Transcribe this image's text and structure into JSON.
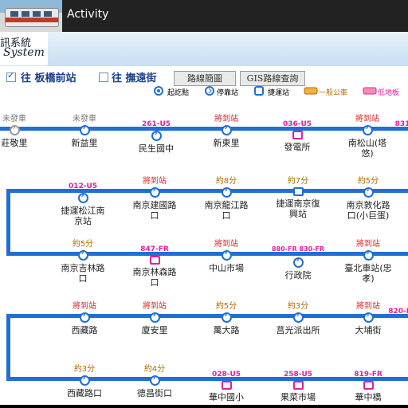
{
  "window": {
    "title": "Activity"
  },
  "banner": {
    "line1": "訊系統",
    "line2": "System"
  },
  "controls": {
    "dir1": "往 板橋前站",
    "dir1_checked": true,
    "dir2": "往 撫遠街",
    "dir2_checked": false,
    "btn_route_map": "路線簡圖",
    "btn_gis": "GIS路線查詢"
  },
  "legend": {
    "start": "起訖點",
    "stop": "停靠站",
    "mrt": "捷運站",
    "general_bus": "一般公車",
    "low_floor": "低地板"
  },
  "rows": [
    {
      "stops": [
        {
          "status": "未發車",
          "status_color": "gray",
          "name": "莊敬里",
          "node": "gray"
        },
        {
          "status": "未發車",
          "status_color": "gray",
          "name": "新益里",
          "node": "blue"
        },
        {
          "status": "261-U5",
          "status_color": "plate",
          "name": "民生國中",
          "node": "blue"
        },
        {
          "status": "將到站",
          "status_color": "red",
          "name": "新東里",
          "node": "blue"
        },
        {
          "status": "036-U5",
          "status_color": "plate",
          "name": "發電所",
          "node": "bus"
        },
        {
          "status": "將到站",
          "status_color": "red",
          "name": "南松山(塔悠)",
          "node": "blue"
        },
        {
          "status": "831",
          "status_color": "plate",
          "name": "",
          "node": "none"
        }
      ]
    },
    {
      "stops": [
        {
          "status": "012-U5",
          "status_color": "plate",
          "name": "捷運松江南京站",
          "node": "blue"
        },
        {
          "status": "將到站",
          "status_color": "red",
          "name": "南京建國路口",
          "node": "blue"
        },
        {
          "status": "約8分",
          "status_color": "brown",
          "name": "南京龍江路口",
          "node": "blue"
        },
        {
          "status": "約7分",
          "status_color": "brown",
          "name": "捷運南京復興站",
          "node": "busblue"
        },
        {
          "status": "約5分",
          "status_color": "brown",
          "name": "南京敦化路口(小巨蛋)",
          "node": "blue"
        }
      ]
    },
    {
      "stops": [
        {
          "status": "約5分",
          "status_color": "brown",
          "name": "南京吉林路口",
          "node": "blue"
        },
        {
          "status": "847-FR",
          "status_color": "plate",
          "name": "南京林森路口",
          "node": "bus"
        },
        {
          "status": "將到站",
          "status_color": "red",
          "name": "中山市場",
          "node": "blue"
        },
        {
          "status": "880-FR 830-FR",
          "status_color": "plate",
          "name": "行政院",
          "node": "blue"
        },
        {
          "status": "將到站",
          "status_color": "red",
          "name": "臺北車站(忠孝)",
          "node": "blue"
        }
      ]
    },
    {
      "stops": [
        {
          "status": "將到站",
          "status_color": "red",
          "name": "西藏路",
          "node": "blue"
        },
        {
          "status": "將到站",
          "status_color": "red",
          "name": "廈安里",
          "node": "blue"
        },
        {
          "status": "約5分",
          "status_color": "brown",
          "name": "萬大路",
          "node": "blue"
        },
        {
          "status": "約3分",
          "status_color": "brown",
          "name": "莒光派出所",
          "node": "blue"
        },
        {
          "status": "將到站",
          "status_color": "red",
          "name": "大埔街",
          "node": "blue"
        },
        {
          "status": "820-FR",
          "status_color": "plate",
          "name": "",
          "node": "none"
        }
      ]
    },
    {
      "stops": [
        {
          "status": "約3分",
          "status_color": "brown",
          "name": "西藏路口",
          "node": "blue"
        },
        {
          "status": "約4分",
          "status_color": "brown",
          "name": "德昌街口",
          "node": "blue"
        },
        {
          "status": "028-U5",
          "status_color": "plate",
          "name": "華中國小",
          "node": "bus"
        },
        {
          "status": "258-U5",
          "status_color": "plate",
          "name": "果菜市場",
          "node": "bus"
        },
        {
          "status": "819-FR",
          "status_color": "plate",
          "name": "華中橋",
          "node": "bus"
        }
      ]
    }
  ]
}
